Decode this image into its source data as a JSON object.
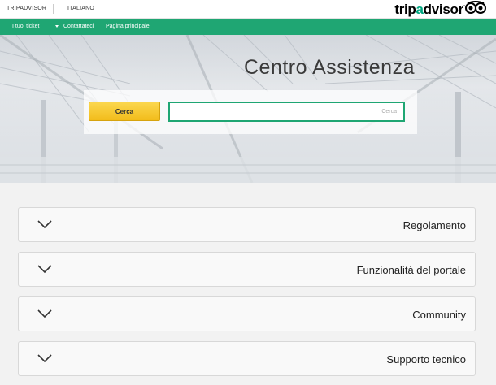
{
  "topbar": {
    "language": "ITALIANO",
    "tripadvisor_link": "TRIPADVISOR",
    "logo": {
      "part_dark_1": "trip",
      "part_green": "a",
      "part_dark_2": "dvisor",
      "mark": "°"
    }
  },
  "nav": {
    "tickets": "I tuoi ticket",
    "contact": "Contattateci",
    "home": "Pagina principale"
  },
  "hero": {
    "title": "Centro Assistenza",
    "search_placeholder": "Cerca",
    "search_button": "Cerca"
  },
  "sections": [
    {
      "label": "Regolamento"
    },
    {
      "label": "Funzionalità del portale"
    },
    {
      "label": "Community"
    },
    {
      "label": "Supporto tecnico"
    }
  ],
  "colors": {
    "brand_green": "#1fa673",
    "button_yellow": "#f5c427",
    "title_gray": "#3a3a3a"
  },
  "icons": [
    "owl-logo-icon",
    "caret-down-icon",
    "chevron-down-icon"
  ]
}
